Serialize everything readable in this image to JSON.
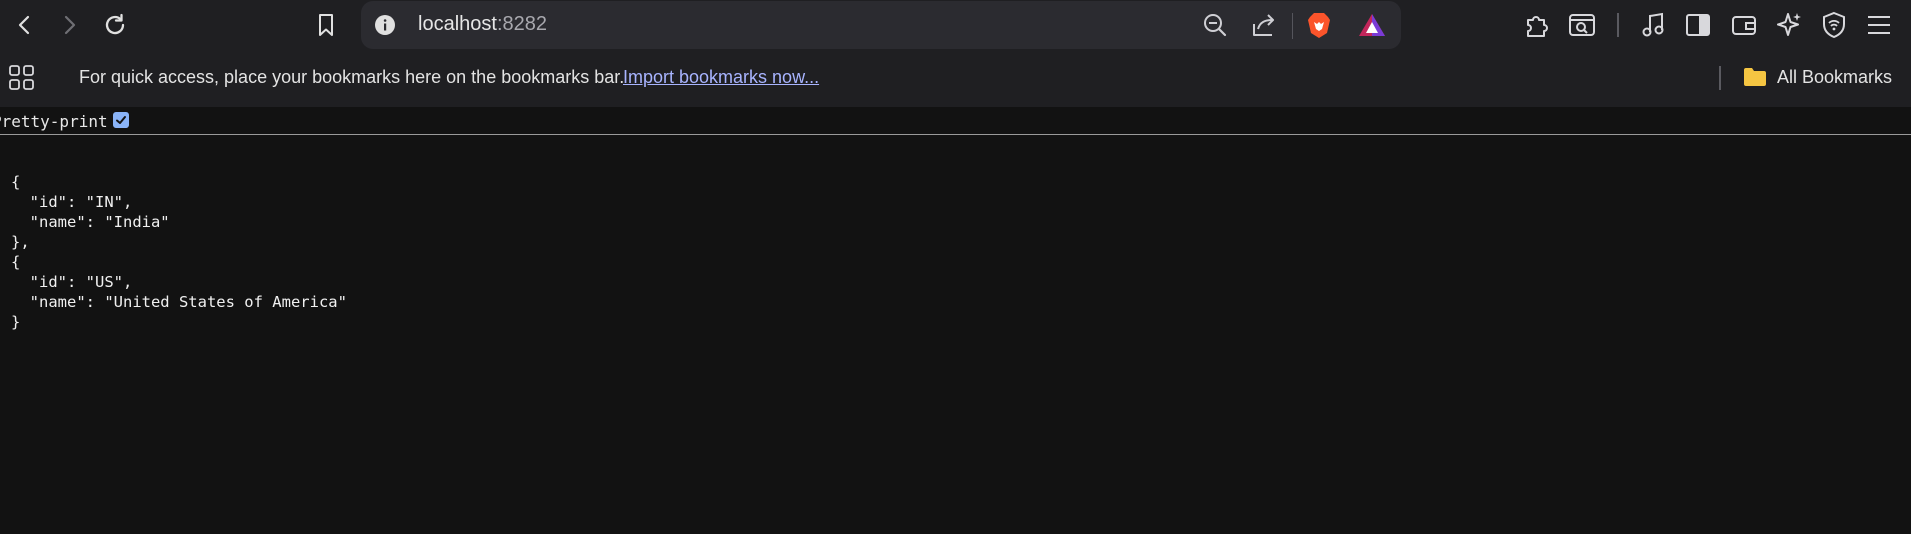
{
  "browser": {
    "url_host": "localhost",
    "url_port": ":8282",
    "icons": {
      "back": "back-arrow-icon",
      "forward": "forward-arrow-icon",
      "reload": "reload-icon",
      "bookmark": "bookmark-icon",
      "site_info": "info-icon",
      "zoom": "zoom-out-icon",
      "share": "share-icon",
      "brave_shields": "brave-lion-icon",
      "brave_rewards": "rewards-triangle-icon",
      "extensions": "puzzle-icon",
      "screenshot": "screen-search-icon",
      "media": "music-note-icon",
      "sidebar": "sidebar-icon",
      "wallet": "wallet-icon",
      "leo": "sparkle-icon",
      "vpn": "vpn-shield-icon",
      "menu": "hamburger-menu-icon"
    }
  },
  "bookmarks_bar": {
    "message": "For quick access, place your bookmarks here on the bookmarks bar.",
    "import_link": "Import bookmarks now...",
    "all_bookmarks": "All Bookmarks"
  },
  "page": {
    "pretty_print_label": "Pretty-print",
    "pretty_print_checked": true,
    "json_lines": [
      "{",
      "  \"id\": \"IN\",",
      "  \"name\": \"India\"",
      "},",
      "{",
      "  \"id\": \"US\",",
      "  \"name\": \"United States of America\"",
      "}"
    ]
  },
  "colors": {
    "toolbar_bg": "#1f1f22",
    "urlbar_bg": "#2b2b30",
    "page_bg": "#121212",
    "link": "#a8b4ff",
    "checkbox": "#8ab4f8",
    "brave_orange": "#fb542b"
  }
}
